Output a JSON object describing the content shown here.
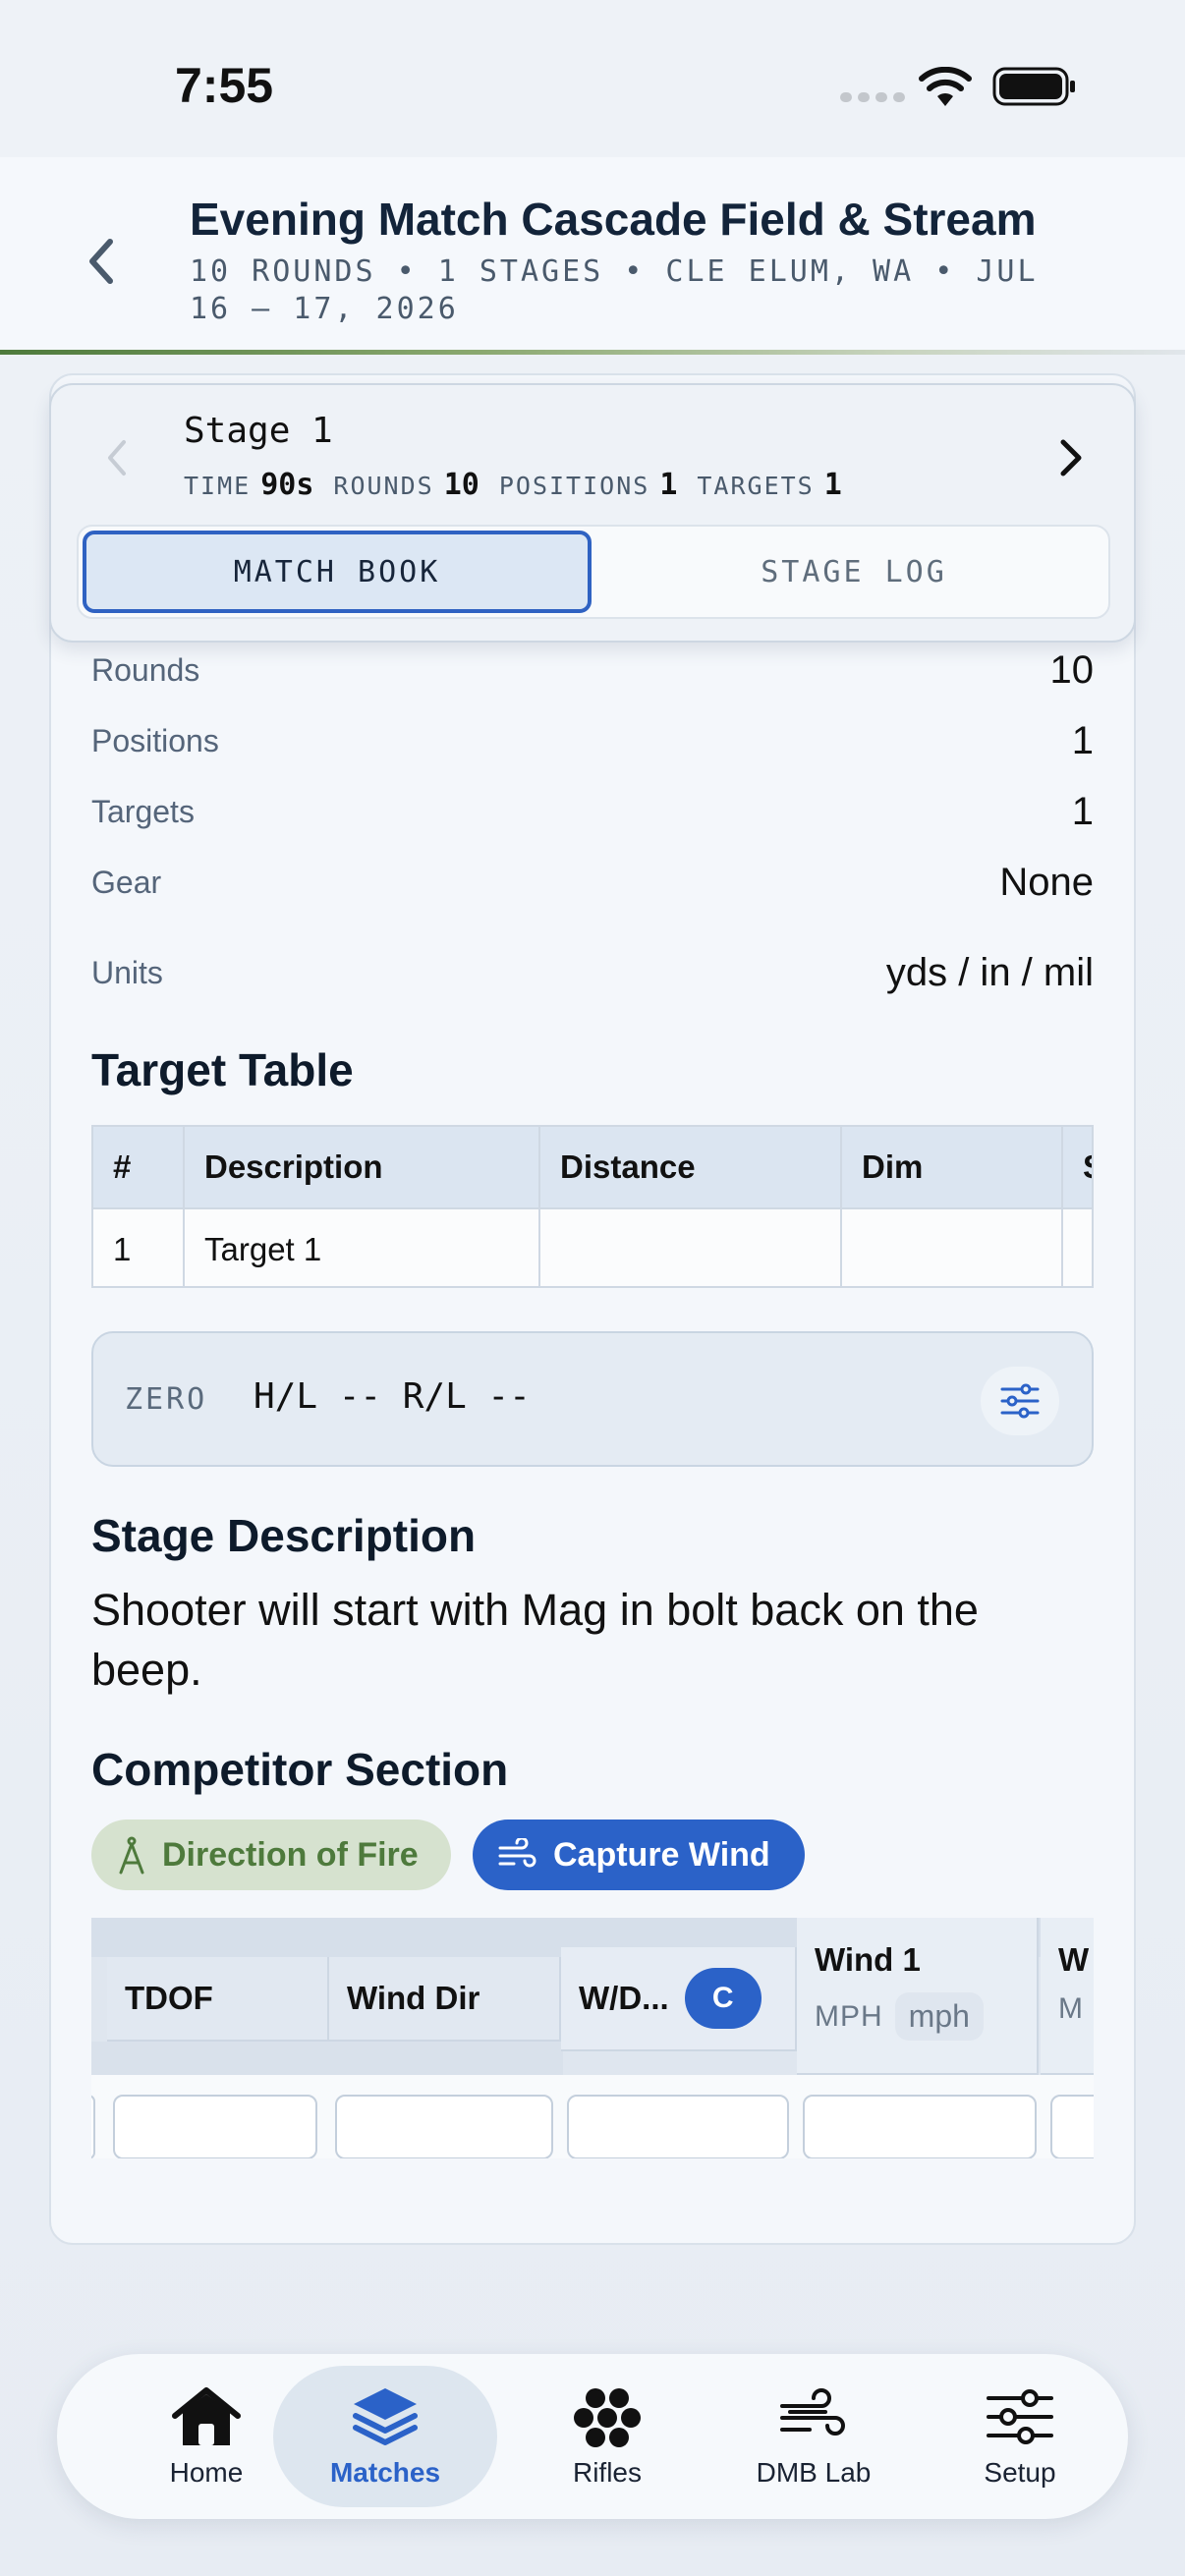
{
  "status_bar": {
    "time": "7:55"
  },
  "header": {
    "title": "Evening Match Cascade Field & Stream",
    "subtitle": "10 ROUNDS • 1 STAGES • CLE ELUM, WA • JUL 16 – 17, 2026"
  },
  "stage": {
    "name": "Stage 1",
    "time_label": "TIME",
    "time_value": "90s",
    "rounds_label": "ROUNDS",
    "rounds_value": "10",
    "positions_label": "POSITIONS",
    "positions_value": "1",
    "targets_label": "TARGETS",
    "targets_value": "1",
    "tabs": [
      {
        "label": "MATCH BOOK",
        "active": true
      },
      {
        "label": "STAGE LOG",
        "active": false
      }
    ]
  },
  "details": [
    {
      "label": "Rounds",
      "value": "10"
    },
    {
      "label": "Positions",
      "value": "1"
    },
    {
      "label": "Targets",
      "value": "1"
    },
    {
      "label": "Gear",
      "value": "None"
    },
    {
      "label": "Units",
      "value": "yds / in / mil"
    }
  ],
  "target_table": {
    "title": "Target Table",
    "columns": [
      "#",
      "Description",
      "Distance",
      "Dim",
      "S"
    ],
    "rows": [
      [
        "1",
        "Target 1",
        "",
        "",
        ""
      ]
    ]
  },
  "zero": {
    "label": "ZERO",
    "value": "H/L -- R/L --",
    "icon": "sliders-icon"
  },
  "stage_description": {
    "title": "Stage Description",
    "text": "Shooter will start with Mag in bolt back on the beep."
  },
  "competitor": {
    "title": "Competitor Section",
    "direction_of_fire": "Direction of Fire",
    "capture_wind": "Capture Wind",
    "columns": {
      "tdof": "TDOF",
      "wind_dir": "Wind Dir",
      "wd": "W/D...",
      "wd_badge": "C",
      "wind1": "Wind 1",
      "wind1_unit": "MPH",
      "wind1_unit_pill": "mph",
      "wind2": "W",
      "wind2_unit": "M"
    }
  },
  "tab_bar": {
    "items": [
      {
        "label": "Home",
        "icon": "home-icon"
      },
      {
        "label": "Matches",
        "icon": "layers-icon",
        "active": true
      },
      {
        "label": "Rifles",
        "icon": "cluster-icon"
      },
      {
        "label": "DMB Lab",
        "icon": "wind-icon"
      },
      {
        "label": "Setup",
        "icon": "sliders-icon"
      }
    ]
  },
  "colors": {
    "accent": "#2b62c8",
    "green": "#4e7a3c",
    "text": "#0f1d2d"
  }
}
